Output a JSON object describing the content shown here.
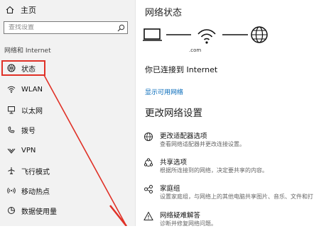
{
  "sidebar": {
    "home_label": "主页",
    "search_placeholder": "查找设置",
    "section_label": "网络和 Internet",
    "items": [
      {
        "label": "状态",
        "icon": "network-status-icon"
      },
      {
        "label": "WLAN",
        "icon": "wifi-icon"
      },
      {
        "label": "以太网",
        "icon": "ethernet-icon"
      },
      {
        "label": "拨号",
        "icon": "dialup-icon"
      },
      {
        "label": "VPN",
        "icon": "vpn-icon"
      },
      {
        "label": "飞行模式",
        "icon": "airplane-icon"
      },
      {
        "label": "移动热点",
        "icon": "hotspot-icon"
      },
      {
        "label": "数据使用量",
        "icon": "data-usage-icon"
      }
    ]
  },
  "main": {
    "title": "网络状态",
    "masked_text": ".com",
    "status_text": "你已连接到 Internet",
    "show_networks_link": "显示可用网络",
    "change_settings_heading": "更改网络设置",
    "options": [
      {
        "title": "更改适配器选项",
        "desc": "查看网络适配器并更改连接设置。",
        "icon": "adapter-globe-icon"
      },
      {
        "title": "共享选项",
        "desc": "根据所连接到的网络，决定要共享的内容。",
        "icon": "sharing-icon"
      },
      {
        "title": "家庭组",
        "desc": "设置家庭组，与网络上的其他电脑共享图片、音乐、文件和打",
        "icon": "homegroup-icon"
      },
      {
        "title": "网络疑难解答",
        "desc": "诊断并修复网络问题。",
        "icon": "troubleshoot-warning-icon"
      }
    ]
  },
  "colors": {
    "accent": "#0067b8",
    "highlight_border": "#e03127",
    "sidebar_bg": "#f2f2f2"
  }
}
